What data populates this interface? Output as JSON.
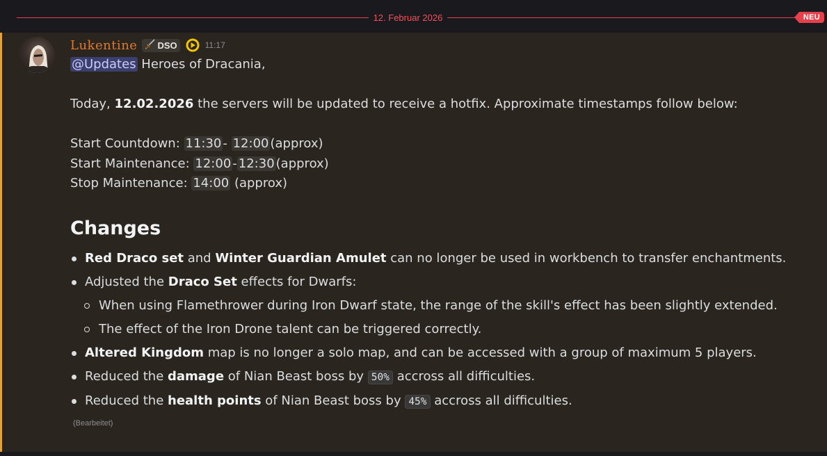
{
  "divider": {
    "date": "12. Februar 2026",
    "new_badge": "NEU"
  },
  "author": {
    "name": "Lukentine",
    "tag": "DSO",
    "tag_icon": "sword-icon",
    "badge_icon": "play-badge-icon",
    "time": "11:17"
  },
  "message": {
    "mention": "@Updates",
    "greeting": " Heroes of Dracania,",
    "intro_pre": "Today, ",
    "intro_date": "12.02.2026",
    "intro_post": " the servers will be updated to receive a hotfix. Approximate timestamps follow below:",
    "schedule": [
      {
        "label": "Start Countdown: ",
        "from": "11:30",
        "sep": "- ",
        "to": "12:00",
        "suffix": "(approx)"
      },
      {
        "label": "Start Maintenance: ",
        "from": "12:00",
        "sep": "-",
        "to": "12:30",
        "suffix": "(approx)"
      },
      {
        "label": "Stop Maintenance: ",
        "at": "14:00",
        "suffix": " (approx)"
      }
    ],
    "heading": "Changes",
    "changes": {
      "c1": {
        "b1": "Red Draco set",
        "t1": " and ",
        "b2": "Winter Guardian Amulet",
        "t2": " can no longer be used in workbench to transfer enchantments."
      },
      "c2": {
        "t1": "Adjusted the ",
        "b1": "Draco Set",
        "t2": " effects for Dwarfs:"
      },
      "c2_sub": [
        "When using Flamethrower during Iron Dwarf state, the range of the skill's effect has been slightly extended.",
        "The effect of the Iron Drone talent can be triggered correctly."
      ],
      "c3": {
        "b1": "Altered Kingdom",
        "t1": " map is no longer a solo map, and can be accessed with a group of maximum 5 players."
      },
      "c4": {
        "t1": "Reduced the ",
        "b1": "damage",
        "t2": " of Nian Beast boss by ",
        "code": "50%",
        "t3": " accross all difficulties."
      },
      "c5": {
        "t1": "Reduced the ",
        "b1": "health points",
        "t2": " of Nian Beast boss by ",
        "code": "45%",
        "t3": " accross all difficulties."
      }
    },
    "edited": "(Bearbeitet)"
  },
  "colors": {
    "accent_bar": "#e3a33c",
    "divider_red": "#e0424e",
    "username": "#e07a2e",
    "mention_bg": "#3c3f6e"
  }
}
